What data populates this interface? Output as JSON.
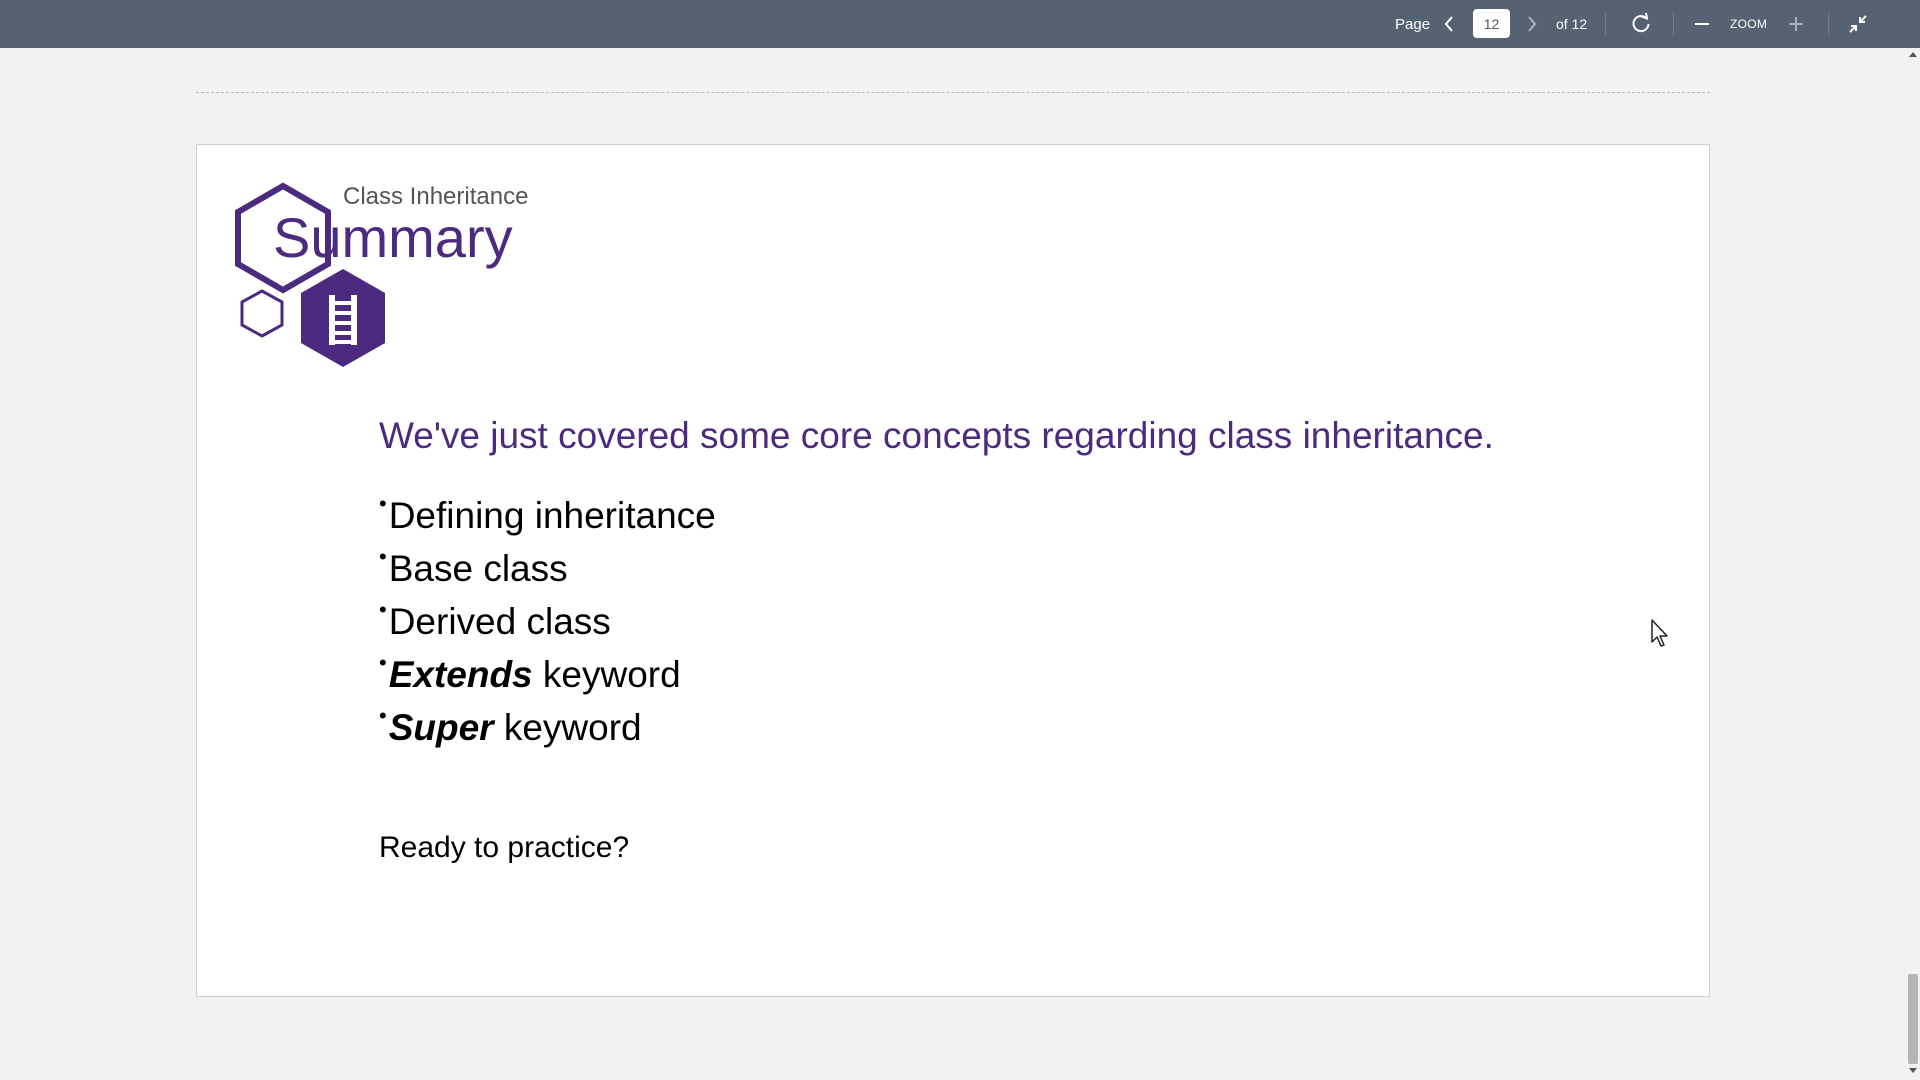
{
  "toolbar": {
    "page_label": "Page",
    "current_page": "12",
    "of_total": "of 12",
    "zoom_label": "ZOOM",
    "icons": {
      "prev": "chevron-left-icon",
      "next": "chevron-right-icon",
      "rotate": "rotate-icon",
      "zoom_out": "minus-icon",
      "zoom_in": "plus-icon",
      "collapse": "collapse-icon"
    }
  },
  "slide": {
    "subtitle": "Class Inheritance",
    "title": "Summary",
    "intro": "We've just covered some core concepts regarding class inheritance.",
    "bullets": [
      {
        "strong": "",
        "text": "Defining inheritance"
      },
      {
        "strong": "",
        "text": "Base class"
      },
      {
        "strong": "",
        "text": "Derived class"
      },
      {
        "strong": "Extends",
        "text": " keyword"
      },
      {
        "strong": "Super",
        "text": " keyword"
      }
    ],
    "bullet_marker": "•",
    "outro": "Ready to practice?"
  },
  "colors": {
    "toolbar_bg": "#546271",
    "accent_purple": "#4b2a7f",
    "page_bg": "#ffffff",
    "viewer_bg": "#f2f2f2"
  }
}
